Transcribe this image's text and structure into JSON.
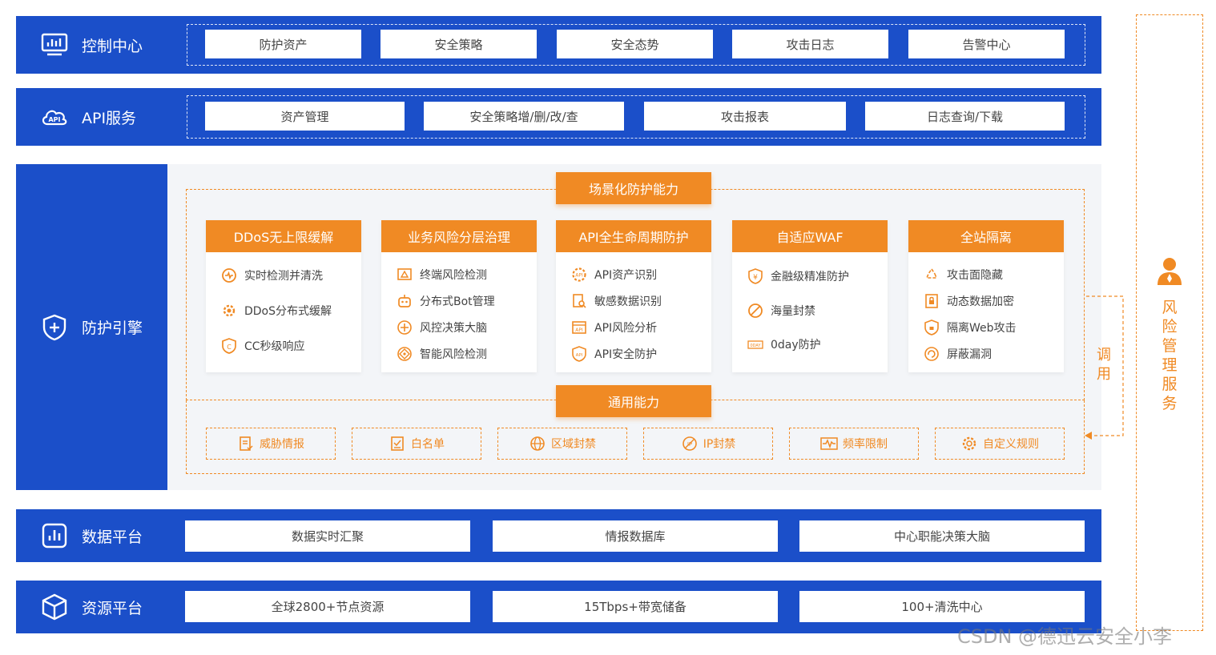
{
  "control_center": {
    "label": "控制中心",
    "items": [
      "防护资产",
      "安全策略",
      "安全态势",
      "攻击日志",
      "告警中心"
    ]
  },
  "api_service": {
    "label": "API服务",
    "items": [
      "资产管理",
      "安全策略增/删/改/查",
      "攻击报表",
      "日志查询/下载"
    ]
  },
  "engine": {
    "label": "防护引擎",
    "scenario_title": "场景化防护能力",
    "cards": [
      {
        "title": "DDoS无上限缓解",
        "features": [
          "实时检测并清洗",
          "DDoS分布式缓解",
          "CC秒级响应"
        ]
      },
      {
        "title": "业务风险分层治理",
        "features": [
          "终端风险检测",
          "分布式Bot管理",
          "风控决策大脑",
          "智能风险检测"
        ]
      },
      {
        "title": "API全生命周期防护",
        "features": [
          "API资产识别",
          "敏感数据识别",
          "API风险分析",
          "API安全防护"
        ]
      },
      {
        "title": "自适应WAF",
        "features": [
          "金融级精准防护",
          "海量封禁",
          "0day防护"
        ]
      },
      {
        "title": "全站隔离",
        "features": [
          "攻击面隐藏",
          "动态数据加密",
          "隔离Web攻击",
          "屏蔽漏洞"
        ]
      }
    ],
    "general_title": "通用能力",
    "general": [
      "威胁情报",
      "白名单",
      "区域封禁",
      "IP封禁",
      "频率限制",
      "自定义规则"
    ]
  },
  "data_platform": {
    "label": "数据平台",
    "items": [
      "数据实时汇聚",
      "情报数据库",
      "中心职能决策大脑"
    ]
  },
  "resource_platform": {
    "label": "资源平台",
    "items": [
      "全球2800+节点资源",
      "15Tbps+带宽储备",
      "100+清洗中心"
    ]
  },
  "risk_service": {
    "label": [
      "风",
      "险",
      "管",
      "理",
      "服",
      "务"
    ],
    "call_label": [
      "调",
      "用"
    ]
  },
  "watermark": "CSDN @德迅云安全小李",
  "colors": {
    "blue": "#1b4fc9",
    "orange": "#f08a24",
    "panel": "#f3f5f8"
  }
}
